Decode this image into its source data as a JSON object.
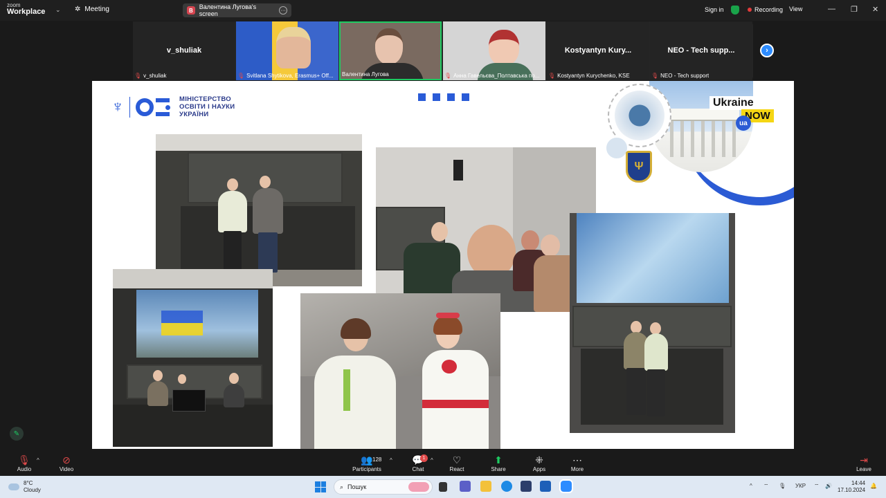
{
  "app": {
    "logo_line1": "zoom",
    "logo_line2": "Workplace",
    "meeting_label": "Meeting",
    "screen_share_badge": "В",
    "screen_share_label": "Валентина Лугова's screen",
    "signin_label": "Sign in",
    "recording_label": "Recording",
    "view_label": "View"
  },
  "participants": [
    {
      "name": "v_shuliak",
      "caption": "v_shuliak",
      "video": false
    },
    {
      "name": "",
      "caption": "Svitlana Shytikova, Erasmus+ Off...",
      "video": true
    },
    {
      "name": "",
      "caption": "Валентина Лугова",
      "video": true
    },
    {
      "name": "",
      "caption": "Анна Гавельєва_Полтавська по...",
      "video": true
    },
    {
      "name": "Kostyantyn Kury...",
      "caption": "Kostyantyn Kurychenko, KSE",
      "video": false
    },
    {
      "name": "NEO - Tech supp...",
      "caption": "NEO - Tech support",
      "video": false
    }
  ],
  "slide": {
    "ministry_line1": "МІНІСТЕРСТВО",
    "ministry_line2": "ОСВІТИ І НАУКИ",
    "ministry_line3": "УКРАЇНИ",
    "badge_ukraine": "Ukraine",
    "badge_now": "NOW",
    "badge_ua": "ua"
  },
  "toolbar": {
    "audio": "Audio",
    "video": "Video",
    "participants": "Participants",
    "participants_count": "128",
    "chat": "Chat",
    "chat_badge": "1",
    "react": "React",
    "share": "Share",
    "apps": "Apps",
    "more": "More",
    "leave": "Leave"
  },
  "windows": {
    "weather_temp": "8°C",
    "weather_desc": "Cloudy",
    "search_placeholder": "Пошук",
    "lang": "УКР",
    "time": "14:44",
    "date": "17.10.2024"
  },
  "colors": {
    "zoom_blue": "#2d8cff",
    "ministry_blue": "#2a5bd7",
    "ukraine_now_yellow": "#f5d614",
    "recording_red": "#e23b3b"
  }
}
